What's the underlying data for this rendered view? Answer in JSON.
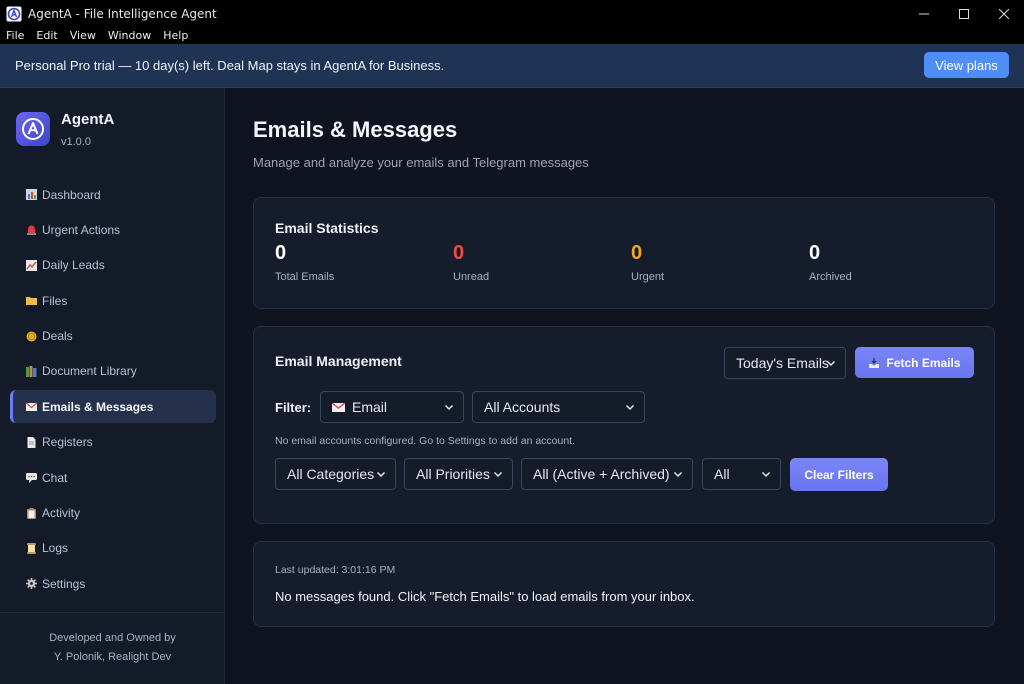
{
  "window": {
    "title": "AgentA - File Intelligence Agent"
  },
  "menu": [
    "File",
    "Edit",
    "View",
    "Window",
    "Help"
  ],
  "banner": {
    "text": "Personal Pro trial — 10 day(s) left. Deal Map stays in AgentA for Business.",
    "button": "View plans"
  },
  "sidebar": {
    "app_name": "AgentA",
    "version": "v1.0.0",
    "items": [
      {
        "label": "Dashboard",
        "icon": "chart-icon"
      },
      {
        "label": "Urgent Actions",
        "icon": "siren-icon"
      },
      {
        "label": "Daily Leads",
        "icon": "trend-icon"
      },
      {
        "label": "Files",
        "icon": "folder-icon"
      },
      {
        "label": "Deals",
        "icon": "coin-icon"
      },
      {
        "label": "Document Library",
        "icon": "books-icon"
      },
      {
        "label": "Emails & Messages",
        "icon": "envelope-icon"
      },
      {
        "label": "Registers",
        "icon": "document-icon"
      },
      {
        "label": "Chat",
        "icon": "speech-icon"
      },
      {
        "label": "Activity",
        "icon": "clipboard-icon"
      },
      {
        "label": "Logs",
        "icon": "scroll-icon"
      },
      {
        "label": "Settings",
        "icon": "gear-icon"
      }
    ],
    "active_index": 6,
    "footer": [
      "Developed and Owned by",
      "Y. Polonik, Realight Dev"
    ]
  },
  "page": {
    "title": "Emails & Messages",
    "subtitle": "Manage and analyze your emails and Telegram messages"
  },
  "stats": {
    "title": "Email Statistics",
    "items": [
      {
        "value": "0",
        "label": "Total Emails",
        "color": "#ffffff"
      },
      {
        "value": "0",
        "label": "Unread",
        "color": "#ef4d43"
      },
      {
        "value": "0",
        "label": "Urgent",
        "color": "#f5a524"
      },
      {
        "value": "0",
        "label": "Archived",
        "color": "#ffffff"
      }
    ]
  },
  "management": {
    "title": "Email Management",
    "range_select": "Today's Emails",
    "fetch_button": "Fetch Emails",
    "filter_label": "Filter:",
    "source_select": "Email",
    "accounts_select": "All Accounts",
    "hint": "No email accounts configured. Go to Settings to add an account.",
    "categories_select": "All Categories",
    "priorities_select": "All Priorities",
    "status_select": "All (Active + Archived)",
    "all_select": "All",
    "clear_button": "Clear Filters"
  },
  "messages": {
    "updated": "Last updated: 3:01:16 PM",
    "empty": "No messages found. Click \"Fetch Emails\" to load emails from your inbox."
  }
}
